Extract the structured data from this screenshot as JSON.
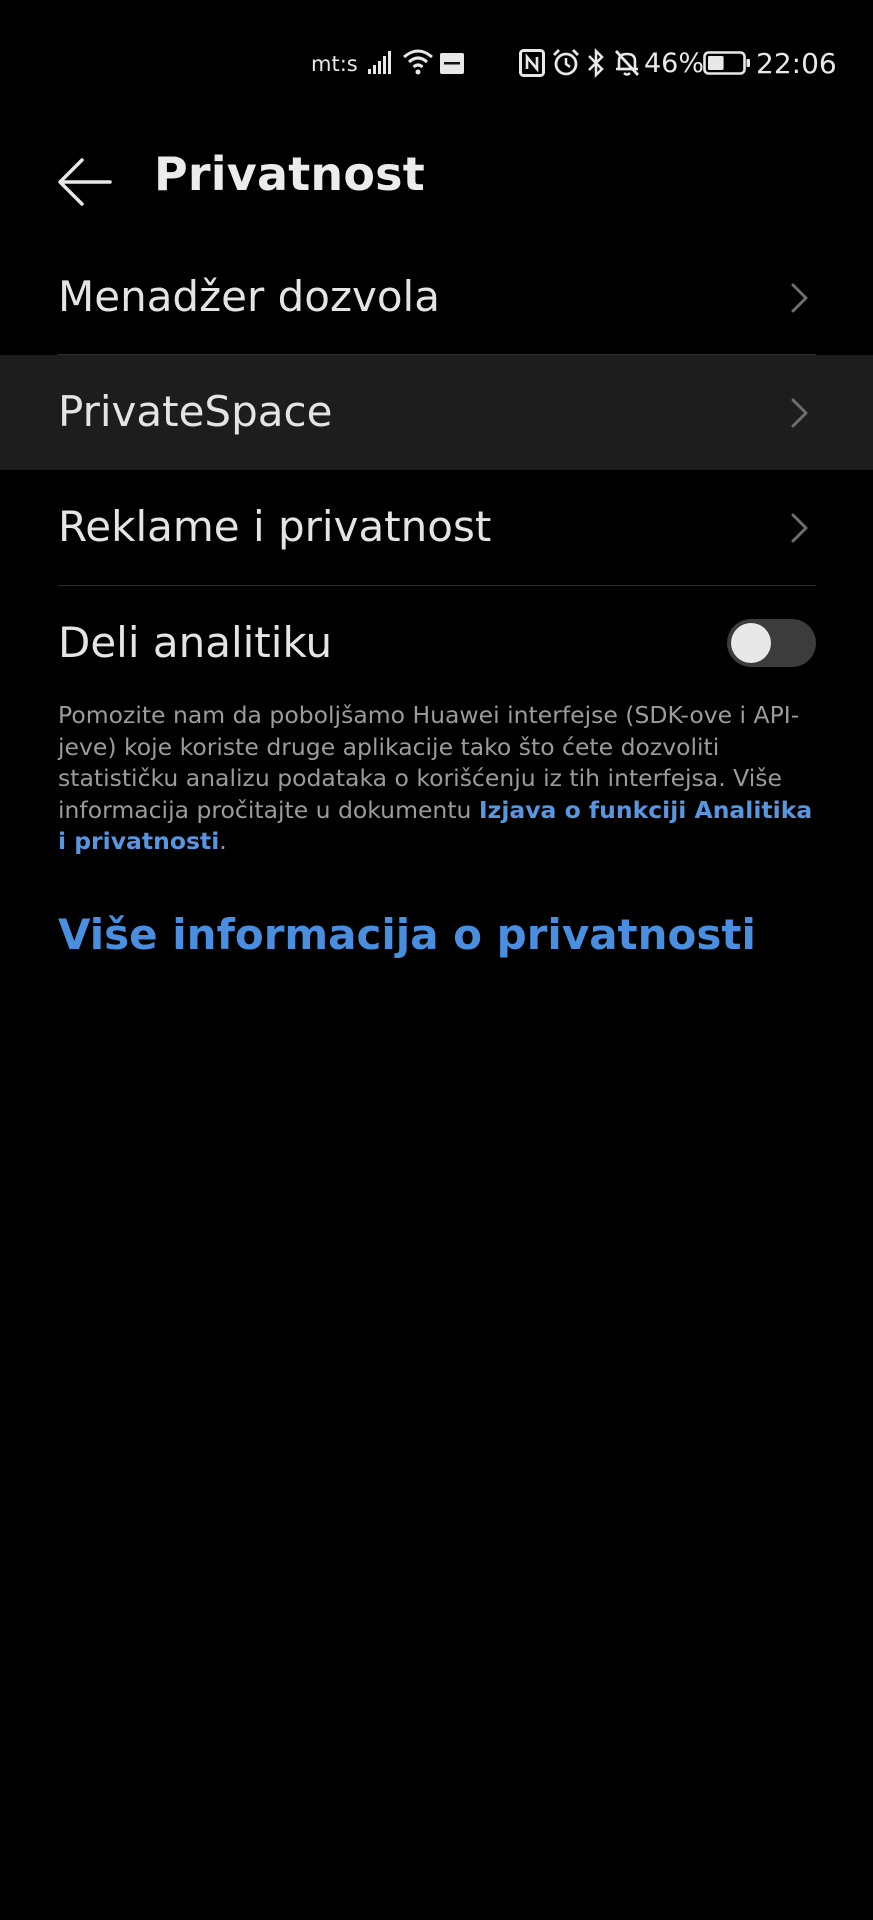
{
  "status_bar": {
    "carrier": "mt:s",
    "battery_percent": "46%",
    "time": "22:06",
    "battery_level": 0.46,
    "icons": [
      "signal-icon",
      "wifi-icon",
      "sonos-icon",
      "nfc-icon",
      "alarm-icon",
      "bluetooth-icon",
      "mute-icon",
      "battery-icon"
    ]
  },
  "header": {
    "title": "Privatnost",
    "back_icon": "arrow-left-icon"
  },
  "items": [
    {
      "label": "Menadžer dozvola"
    },
    {
      "label": "PrivateSpace"
    },
    {
      "label": "Reklame i privatnost"
    }
  ],
  "analytics": {
    "label": "Deli analitiku",
    "enabled": false,
    "description_text": "Pomozite nam da poboljšamo Huawei interfejse (SDK-ove i API-jeve) koje koriste druge aplikacije tako što ćete dozvoliti statističku analizu podataka o korišćenju iz tih interfejsa. Više informacija pročitajte u dokumentu ",
    "description_link": "Izjava o funkciji Analitika i privatnosti",
    "description_end": "."
  },
  "more_info": {
    "label": "Više informacija o privatnosti"
  },
  "colors": {
    "background": "#000000",
    "highlight_row": "#1d1d1d",
    "accent": "#4a8fdf",
    "text": "#e4e4e4",
    "secondary_text": "#9b9b9b"
  }
}
